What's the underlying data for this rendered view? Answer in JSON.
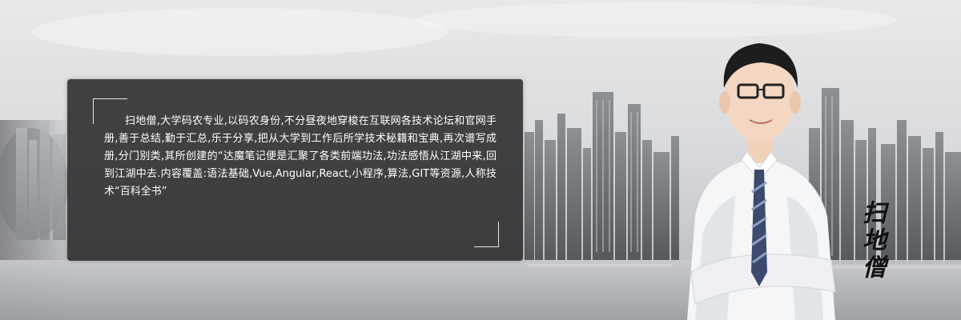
{
  "banner": {
    "bio_text": "扫地僧,大学码农专业,以码农身份,不分昼夜地穿梭在互联网各技术论坛和官网手册,善于总结,勤于汇总,乐于分享,把从大学到工作后所学技术秘籍和宝典,再次谱写成册,分门别类,其所创建的“达魔笔记便是汇聚了各类前端功法,功法感悟从江湖中来,回到江湖中去.内容覆盖:语法基础,Vue,Angular,React,小程序,算法,GIT等资源,人称技术“百科全书”",
    "signature": "扫地僧"
  },
  "colors": {
    "panel": "#262628",
    "text": "#ffffff",
    "signature": "#111111"
  },
  "icons": {
    "corner_top_left": "bracket-corner-icon",
    "corner_bottom_right": "bracket-corner-icon"
  }
}
